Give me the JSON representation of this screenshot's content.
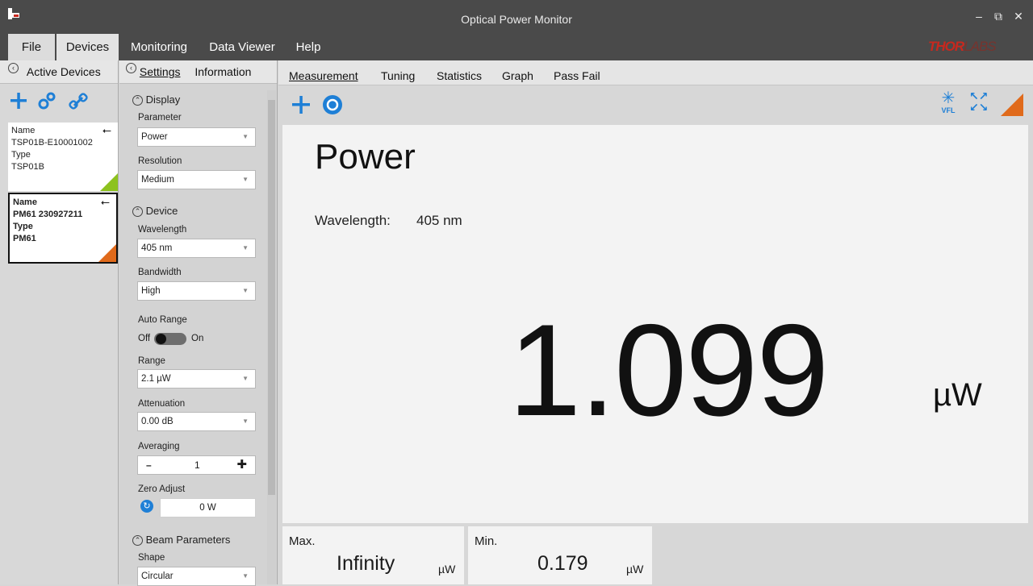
{
  "window": {
    "title": "Optical Power Monitor"
  },
  "menu": {
    "file": "File",
    "devices": "Devices",
    "monitoring": "Monitoring",
    "data_viewer": "Data Viewer",
    "help": "Help"
  },
  "logo": {
    "main": "THOR",
    "rest": "LABS"
  },
  "active_devices": {
    "title": "Active Devices",
    "devices": [
      {
        "name_label": "Name",
        "name": "TSP01B-E10001002",
        "type_label": "Type",
        "type": "TSP01B",
        "accent": "#8dc21f"
      },
      {
        "name_label": "Name",
        "name": "PM61 230927211",
        "type_label": "Type",
        "type": "PM61",
        "accent": "#e06a1b"
      }
    ]
  },
  "settings": {
    "tab_settings": "Settings",
    "tab_information": "Information",
    "display_section": "Display",
    "parameter_label": "Parameter",
    "parameter_value": "Power",
    "resolution_label": "Resolution",
    "resolution_value": "Medium",
    "device_section": "Device",
    "wavelength_label": "Wavelength",
    "wavelength_value": "405 nm",
    "bandwidth_label": "Bandwidth",
    "bandwidth_value": "High",
    "auto_range_label": "Auto Range",
    "auto_range_off": "Off",
    "auto_range_on": "On",
    "range_label": "Range",
    "range_value": "2.1 µW",
    "attenuation_label": "Attenuation",
    "attenuation_value": "0.00 dB",
    "averaging_label": "Averaging",
    "averaging_value": "1",
    "zero_adjust_label": "Zero Adjust",
    "zero_adjust_value": "0 W",
    "beam_section": "Beam Parameters",
    "shape_label": "Shape",
    "shape_value": "Circular"
  },
  "main": {
    "tabs": [
      "Measurement",
      "Tuning",
      "Statistics",
      "Graph",
      "Pass Fail"
    ],
    "vfl_label": "VFL",
    "title": "Power",
    "wavelength_label": "Wavelength:",
    "wavelength_value": "405 nm",
    "value": "1.099",
    "unit": "µW",
    "max_label": "Max.",
    "max_value": "Infinity",
    "max_unit": "µW",
    "min_label": "Min.",
    "min_value": "0.179",
    "min_unit": "µW"
  },
  "colors": {
    "blue_icon": "#1e7fd6",
    "orange": "#e06a1b",
    "green": "#8dc21f"
  }
}
